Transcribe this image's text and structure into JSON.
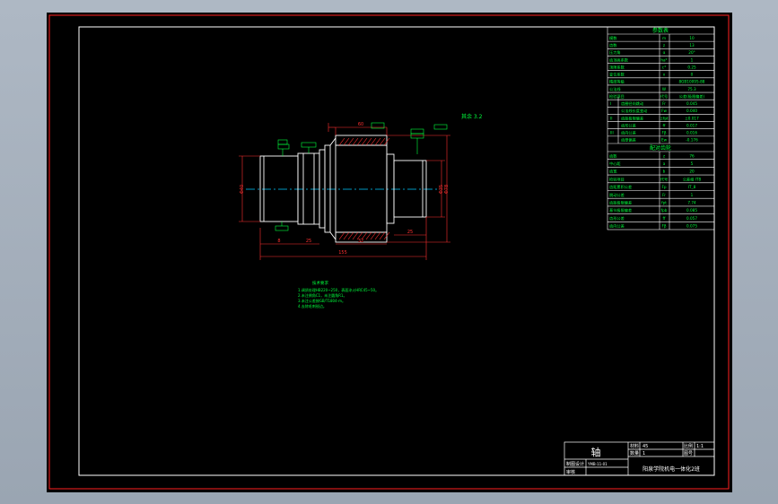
{
  "drawing": {
    "part_title": "轴",
    "material": "45",
    "quantity": "1",
    "scale_label": "比例",
    "scale_value": "1:1",
    "sheet_label": "图号",
    "material_label": "材料",
    "quantity_label": "数量",
    "drafter_label": "制图",
    "designer_label": "设计",
    "checker_label": "审核",
    "drawing_no": "YMB-11-01",
    "school": "阳泉学院机电一体化2班"
  },
  "annotations": {
    "roughness_note": "其余 3.2",
    "requirements_title": "技术要求",
    "requirements_lines": [
      "1.调质处理HB220~250，表面淬火HRC45~50。",
      "2.未注倒角C1，未注圆角R1。",
      "3.未注公差按GB/T1804-m。",
      "4.去除毛刺锐边。"
    ]
  },
  "dimensions": {
    "overall_length": "155",
    "seg_1": "8",
    "seg_2": "25",
    "seg_3": "32",
    "seg_4": "25",
    "gear_face": "60",
    "left_dia": "Φ40",
    "right_dia": "Φ35",
    "gear_dia": "Φ78"
  },
  "params_table": {
    "header": "参数表",
    "rows": [
      [
        "模数",
        "m",
        "10"
      ],
      [
        "齿数",
        "z",
        "13"
      ],
      [
        "压力角",
        "α",
        "20°"
      ],
      [
        "齿顶高系数",
        "ha*",
        "1"
      ],
      [
        "顶隙系数",
        "c*",
        "0.25"
      ],
      [
        "变位系数",
        "x",
        "0"
      ],
      [
        "精度等级",
        "",
        "8GB10095-88"
      ],
      [
        "公法线",
        "W",
        "75.3"
      ],
      [
        "检验项目",
        "代号",
        "公差(极限偏差)"
      ],
      [
        "I",
        "齿圈径向跳动",
        "Fr",
        "0.045"
      ],
      [
        "",
        "公法线长度变动",
        "Fw",
        "0.040"
      ],
      [
        "II",
        "齿距极限偏差",
        "±fpt",
        "±0.017"
      ],
      [
        "",
        "齿形公差",
        "ff",
        "0.017"
      ],
      [
        "III",
        "齿向公差",
        "Fβ",
        "0.016"
      ],
      [
        "",
        "齿厚偏差",
        "Ew",
        "-0.176"
      ]
    ],
    "mating_header": "配对齿轮",
    "mating_rows": [
      [
        "齿数",
        "z",
        "76"
      ],
      [
        "中心距",
        "a",
        "5"
      ],
      [
        "齿宽",
        "b",
        "20"
      ],
      [
        "检验项目",
        "代号",
        "公差组 IT8"
      ],
      [
        "齿距累积公差",
        "Fp",
        "IT_8"
      ],
      [
        "跳动公差",
        "Fr",
        "1"
      ],
      [
        "齿距极限偏差",
        "fpt",
        "7.74"
      ],
      [
        "基节极限偏差",
        "fpb",
        "0.085"
      ],
      [
        "齿形公差",
        "ff",
        "0.057"
      ],
      [
        "齿向公差",
        "Fβ",
        "0.075"
      ]
    ]
  },
  "colors": {
    "frame": "#ff2020",
    "border": "#ffffff",
    "annotation": "#00ff3c",
    "centerline": "#00c8ff",
    "hatch": "#ff3030"
  }
}
